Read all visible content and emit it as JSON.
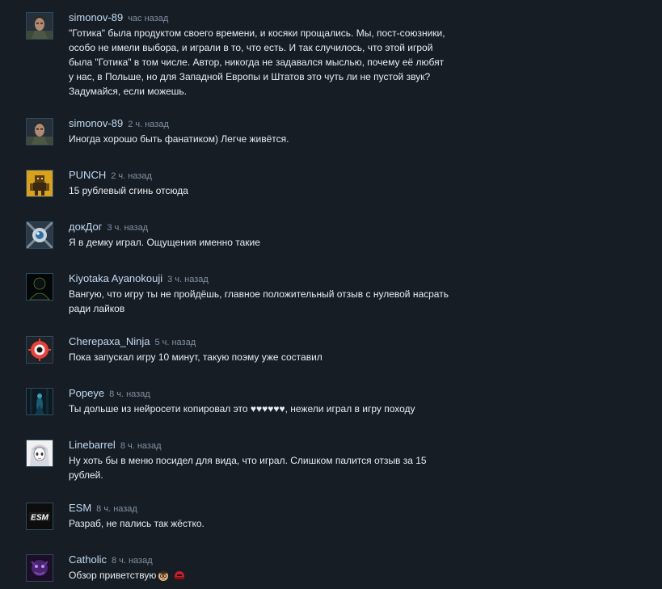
{
  "comments": [
    {
      "author": "simonov-89",
      "time": "час назад",
      "text": "\"Готика\" была продуктом своего времени, и косяки прощались. Мы, пост-союзники, особо не имели выбора, и играли в то, что есть. И так случилось, что этой игрой была \"Готика\" в том числе. Автор, никогда не задавался мыслью, почему её любят у нас, в Польше, но для Западной Европы и Штатов это чуть ли не пустой звук? Задумайся, если можешь.",
      "avatar": "soldier-portrait-icon"
    },
    {
      "author": "simonov-89",
      "time": "2 ч. назад",
      "text": "Иногда хорошо быть фанатиком) Легче живётся.",
      "avatar": "soldier-portrait-icon"
    },
    {
      "author": "PUNCH",
      "time": "2 ч. назад",
      "text": "15 рублевый сгинь отсюда",
      "avatar": "yellow-robot-icon"
    },
    {
      "author": "докДог",
      "time": "3 ч. назад",
      "text": "Я в демку играл. Ощущения именно такие",
      "avatar": "silver-orb-icon"
    },
    {
      "author": "Kiyotaka Ayanokouji",
      "time": "3 ч. назад",
      "text": "Вангую, что игру ты не пройдёшь, главное положительный отзыв с нулевой насрать ради лайков",
      "avatar": "dark-silhouette-icon"
    },
    {
      "author": "Cherepaxa_Ninja",
      "time": "5 ч. назад",
      "text": "Пока запускал игру 10 минут, такую поэму уже составил",
      "avatar": "red-eye-icon"
    },
    {
      "author": "Popeye",
      "time": "8 ч. назад",
      "text": "Ты дольше из нейросети копировал это ♥♥♥♥♥♥, нежели играл в игру походу",
      "avatar": "dark-forest-figure-icon"
    },
    {
      "author": "Linebarrel",
      "time": "8 ч. назад",
      "text": "Ну хоть бы в меню посидел для вида, что играл. Слишком палится отзыв за 15 рублей.",
      "avatar": "anime-girl-icon"
    },
    {
      "author": "ESM",
      "time": "8 ч. назад",
      "text": "Разраб, не пались так жёстко.",
      "avatar": "esm-logo-icon",
      "avatar_logo_text": "ESM"
    },
    {
      "author": "Catholic",
      "time": "8 ч. назад",
      "text": "Обзор приветствую",
      "avatar": "purple-monster-icon",
      "emojis": [
        "scholar-emoticon-icon",
        "red-helmet-emoticon-icon"
      ]
    }
  ],
  "colors": {
    "background": "#171d25",
    "author": "#c1dbf4",
    "timestamp": "#8091a2",
    "text": "#e6edf3"
  }
}
